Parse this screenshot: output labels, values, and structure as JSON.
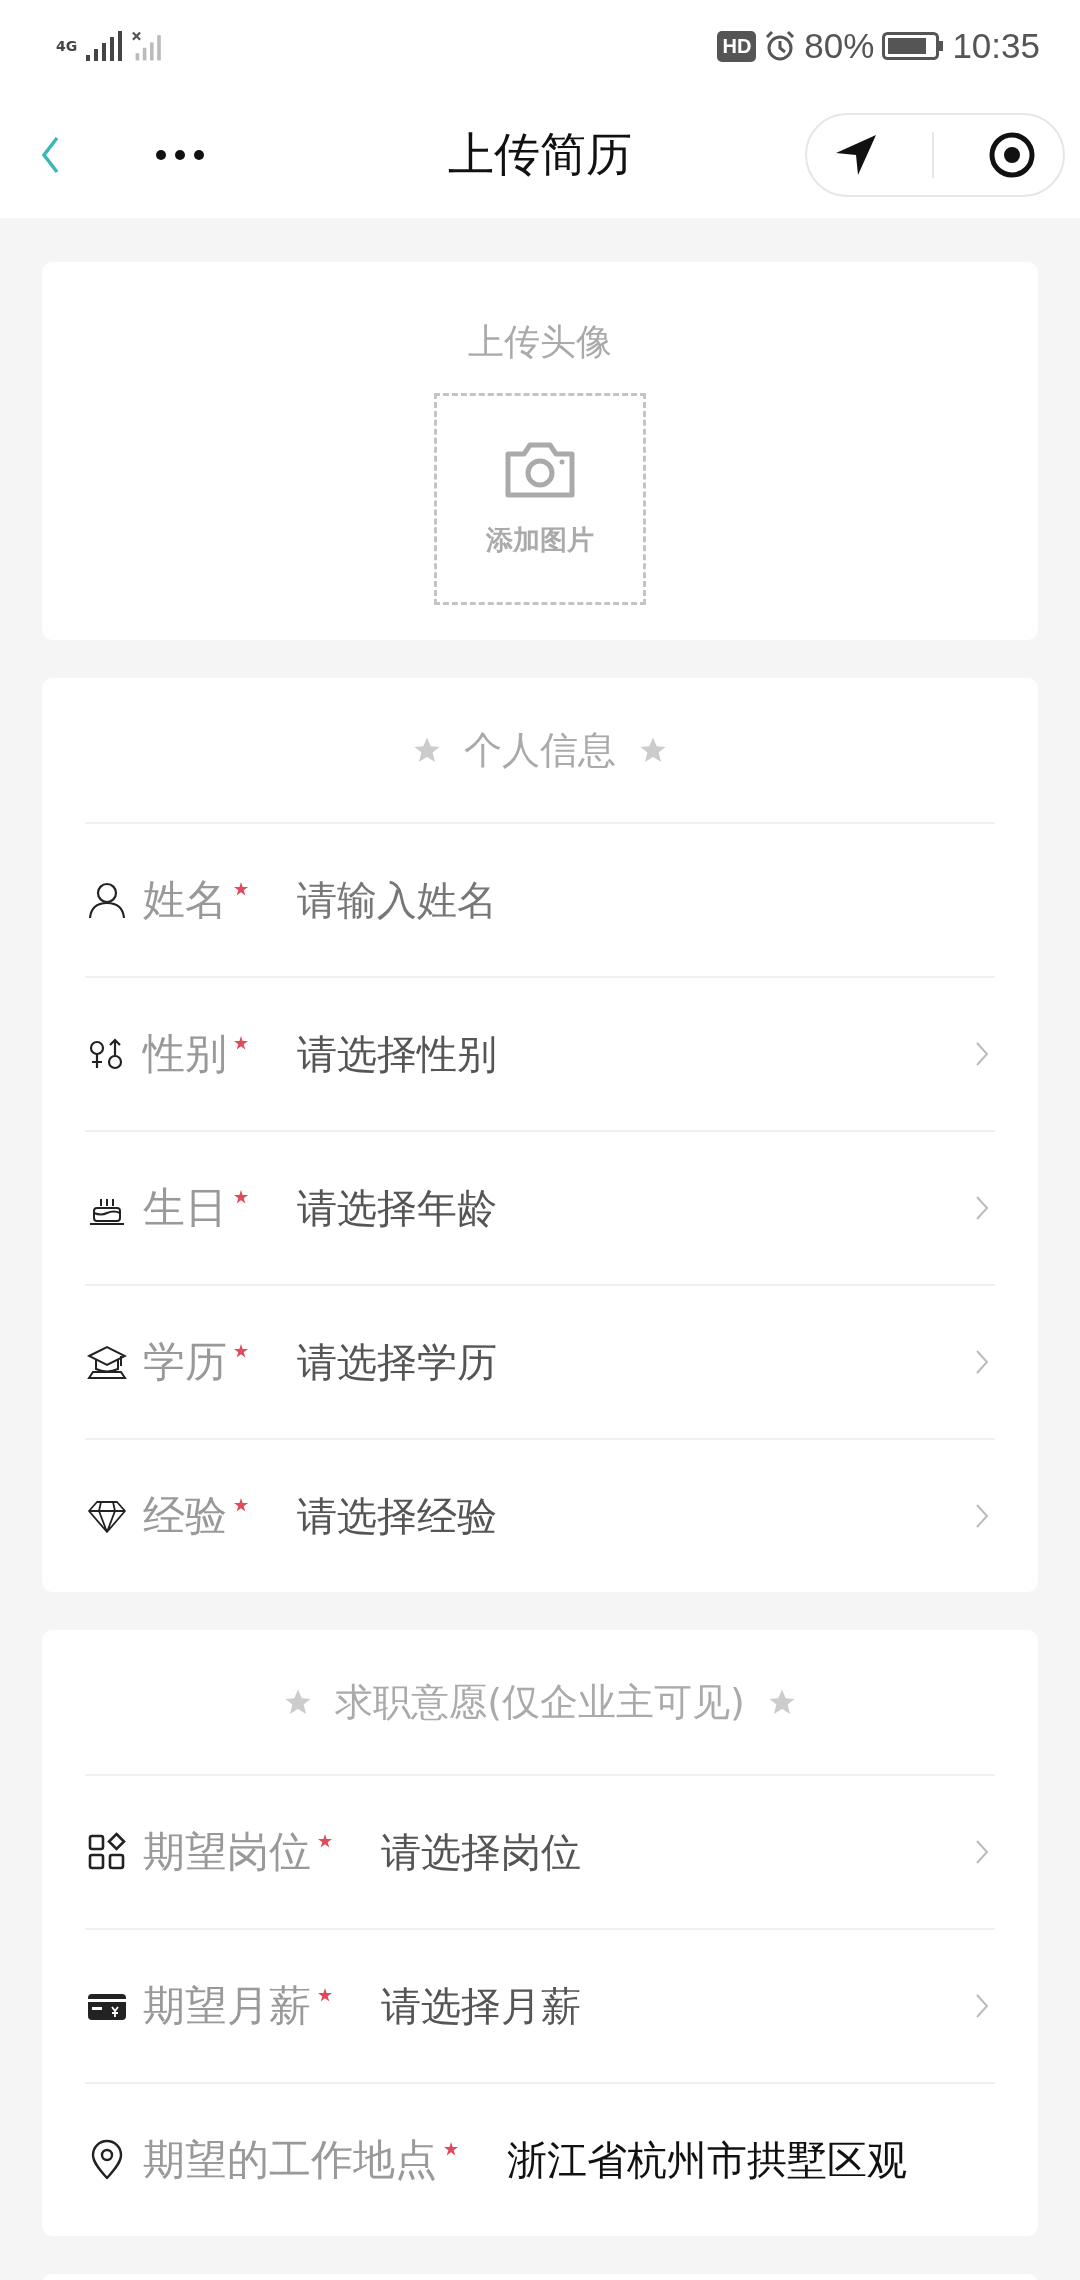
{
  "status_bar": {
    "network": "4G",
    "hd_badge": "HD",
    "battery_text": "80%",
    "time": "10:35"
  },
  "header": {
    "title": "上传简历"
  },
  "avatar_card": {
    "title": "上传头像",
    "add_label": "添加图片"
  },
  "sections": [
    {
      "title": "个人信息",
      "rows": [
        {
          "kind": "input",
          "label": "姓名",
          "required": true,
          "placeholder": "请输入姓名"
        },
        {
          "kind": "select",
          "label": "性别",
          "required": true,
          "placeholder": "请选择性别"
        },
        {
          "kind": "select",
          "label": "生日",
          "required": true,
          "placeholder": "请选择年龄"
        },
        {
          "kind": "select",
          "label": "学历",
          "required": true,
          "placeholder": "请选择学历"
        },
        {
          "kind": "select",
          "label": "经验",
          "required": true,
          "placeholder": "请选择经验"
        }
      ]
    },
    {
      "title": "求职意愿(仅企业主可见)",
      "rows": [
        {
          "kind": "select",
          "label": "期望岗位",
          "required": true,
          "placeholder": "请选择岗位"
        },
        {
          "kind": "select",
          "label": "期望月薪",
          "required": true,
          "placeholder": "请选择月薪"
        },
        {
          "kind": "text",
          "label": "期望的工作地点",
          "required": true,
          "value": "浙江省杭州市拱墅区观"
        }
      ]
    }
  ]
}
